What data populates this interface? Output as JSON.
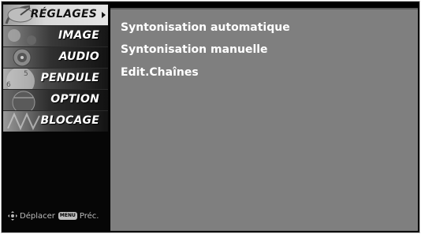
{
  "menu": {
    "items": [
      {
        "label": "RÉGLAGES",
        "active": true
      },
      {
        "label": "IMAGE",
        "active": false
      },
      {
        "label": "AUDIO",
        "active": false
      },
      {
        "label": "PENDULE",
        "active": false
      },
      {
        "label": "OPTION",
        "active": false
      },
      {
        "label": "BLOCAGE",
        "active": false
      }
    ]
  },
  "footer": {
    "move_label": "Déplacer",
    "menu_key": "MENU",
    "prev_label": "Préc."
  },
  "submenu": {
    "options": [
      {
        "label": "Syntonisation automatique"
      },
      {
        "label": "Syntonisation manuelle"
      },
      {
        "label": "Edit.Chaînes"
      }
    ]
  },
  "colors": {
    "content_background": "#7f7f7f",
    "sidebar_background": "#060606",
    "active_item_background": "#d8d8d8",
    "text": "#ffffff"
  }
}
